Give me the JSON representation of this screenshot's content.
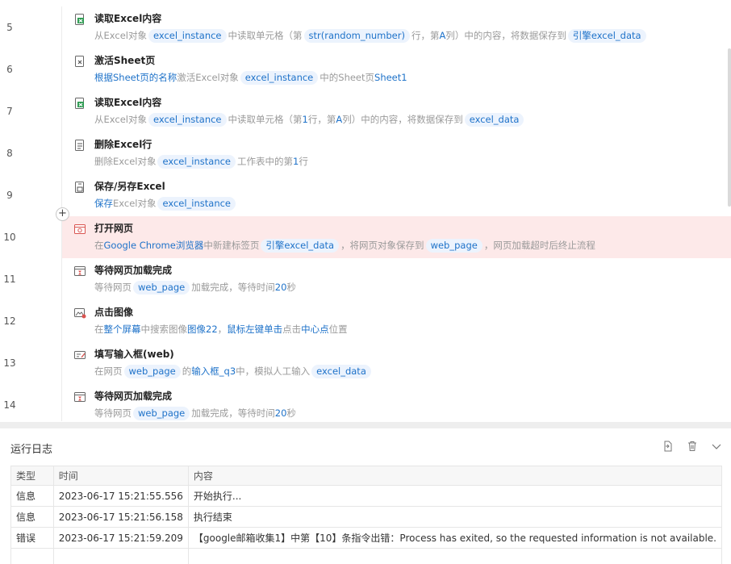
{
  "flow": {
    "steps": [
      {
        "num": "5",
        "icon": "excel-read-icon",
        "title": "读取Excel内容",
        "desc": [
          {
            "k": "t",
            "v": "从Excel对象"
          },
          {
            "k": "chip",
            "v": "excel_instance"
          },
          {
            "k": "t",
            "v": "中读取单元格（第"
          },
          {
            "k": "chip",
            "v": "str(random_number)"
          },
          {
            "k": "t",
            "v": "行，第"
          },
          {
            "k": "kw",
            "v": "A"
          },
          {
            "k": "t",
            "v": "列）中的内容，将数据保存到"
          },
          {
            "k": "chip",
            "v": "引擎excel_data"
          }
        ]
      },
      {
        "num": "6",
        "icon": "excel-sheet-icon",
        "title": "激活Sheet页",
        "desc": [
          {
            "k": "kw",
            "v": "根据Sheet页的名称"
          },
          {
            "k": "t",
            "v": "激活Excel对象"
          },
          {
            "k": "chip",
            "v": "excel_instance"
          },
          {
            "k": "t",
            "v": "中的Sheet页"
          },
          {
            "k": "kw",
            "v": "Sheet1"
          }
        ]
      },
      {
        "num": "7",
        "icon": "excel-read-icon",
        "title": "读取Excel内容",
        "desc": [
          {
            "k": "t",
            "v": "从Excel对象"
          },
          {
            "k": "chip",
            "v": "excel_instance"
          },
          {
            "k": "t",
            "v": "中读取单元格（第"
          },
          {
            "k": "kw",
            "v": "1"
          },
          {
            "k": "t",
            "v": "行，第"
          },
          {
            "k": "kw",
            "v": "A"
          },
          {
            "k": "t",
            "v": "列）中的内容，将数据保存到"
          },
          {
            "k": "chip",
            "v": "excel_data"
          }
        ]
      },
      {
        "num": "8",
        "icon": "excel-delete-row-icon",
        "title": "删除Excel行",
        "desc": [
          {
            "k": "t",
            "v": "删除Excel对象"
          },
          {
            "k": "chip",
            "v": "excel_instance"
          },
          {
            "k": "t",
            "v": "工作表中的第"
          },
          {
            "k": "kw",
            "v": "1"
          },
          {
            "k": "t",
            "v": "行"
          }
        ]
      },
      {
        "num": "9",
        "icon": "excel-save-icon",
        "title": "保存/另存Excel",
        "desc": [
          {
            "k": "kw",
            "v": "保存"
          },
          {
            "k": "t",
            "v": "Excel对象"
          },
          {
            "k": "chip",
            "v": "excel_instance"
          }
        ]
      },
      {
        "num": "10",
        "icon": "browser-open-icon",
        "title": "打开网页",
        "error": true,
        "desc": [
          {
            "k": "t",
            "v": "在"
          },
          {
            "k": "kw",
            "v": "Google Chrome浏览器"
          },
          {
            "k": "t",
            "v": "中新建标签页"
          },
          {
            "k": "chip",
            "v": "引擎excel_data"
          },
          {
            "k": "t",
            "v": "，将网页对象保存到"
          },
          {
            "k": "chip",
            "v": "web_page"
          },
          {
            "k": "t",
            "v": "，网页加载超时后终止流程"
          }
        ]
      },
      {
        "num": "11",
        "icon": "browser-wait-icon",
        "title": "等待网页加载完成",
        "desc": [
          {
            "k": "t",
            "v": "等待网页"
          },
          {
            "k": "chip",
            "v": "web_page"
          },
          {
            "k": "t",
            "v": "加载完成，等待时间"
          },
          {
            "k": "kw",
            "v": "20"
          },
          {
            "k": "t",
            "v": "秒"
          }
        ]
      },
      {
        "num": "12",
        "icon": "image-click-icon",
        "title": "点击图像",
        "desc": [
          {
            "k": "t",
            "v": "在"
          },
          {
            "k": "kw",
            "v": "整个屏幕"
          },
          {
            "k": "t",
            "v": "中搜索图像"
          },
          {
            "k": "kw",
            "v": "图像22"
          },
          {
            "k": "t",
            "v": "，"
          },
          {
            "k": "kw",
            "v": "鼠标左键单击"
          },
          {
            "k": "t",
            "v": "点击"
          },
          {
            "k": "kw",
            "v": "中心点"
          },
          {
            "k": "t",
            "v": "位置"
          }
        ]
      },
      {
        "num": "13",
        "icon": "input-fill-icon",
        "title": "填写输入框(web)",
        "desc": [
          {
            "k": "t",
            "v": "在网页"
          },
          {
            "k": "chip",
            "v": "web_page"
          },
          {
            "k": "t",
            "v": "的"
          },
          {
            "k": "kw",
            "v": "输入框_q3"
          },
          {
            "k": "t",
            "v": "中，模拟人工输入"
          },
          {
            "k": "chip",
            "v": "excel_data"
          }
        ]
      },
      {
        "num": "14",
        "icon": "browser-wait-icon",
        "title": "等待网页加载完成",
        "desc": [
          {
            "k": "t",
            "v": "等待网页"
          },
          {
            "k": "chip",
            "v": "web_page"
          },
          {
            "k": "t",
            "v": "加载完成，等待时间"
          },
          {
            "k": "kw",
            "v": "20"
          },
          {
            "k": "t",
            "v": "秒"
          }
        ]
      }
    ],
    "add_button": "+"
  },
  "log": {
    "title": "运行日志",
    "actions": [
      "export-icon",
      "trash-icon",
      "chevron-down-icon"
    ],
    "columns": [
      "类型",
      "时间",
      "内容"
    ],
    "rows": [
      {
        "type": "信息",
        "time": "2023-06-17 15:21:55.556",
        "content": "开始执行..."
      },
      {
        "type": "信息",
        "time": "2023-06-17 15:21:56.158",
        "content": "执行结束"
      },
      {
        "type": "错误",
        "time": "2023-06-17 15:21:59.209",
        "content": "【google邮箱收集1】中第【10】条指令出错：Process has exited, so the requested information is not available."
      }
    ]
  },
  "colors": {
    "accent": "#1e72c9",
    "chip_bg": "#ecf3fd",
    "error_row": "#fde9e9",
    "muted": "#9a9a9a"
  }
}
